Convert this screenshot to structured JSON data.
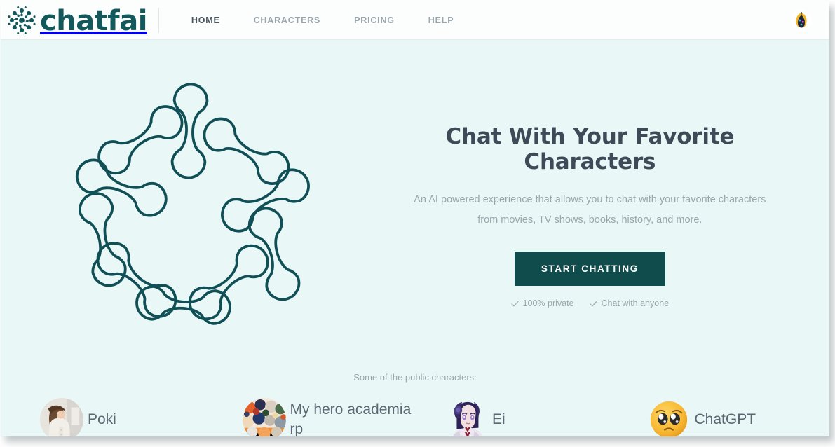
{
  "brand": {
    "name": "chatfai",
    "logo_icon": "network-nodes-icon",
    "color": "#13595c"
  },
  "nav": {
    "links": [
      {
        "label": "HOME",
        "active": true
      },
      {
        "label": "CHARACTERS",
        "active": false
      },
      {
        "label": "PRICING",
        "active": false
      },
      {
        "label": "HELP",
        "active": false
      }
    ],
    "avatar_icon": "user-avatar"
  },
  "hero": {
    "illustration_icon": "radial-dumbbell-pattern-illustration",
    "title": "Chat With Your Favorite Characters",
    "subtitle": "An AI powered experience that allows you to chat with your favorite characters from movies, TV shows, books, history, and more.",
    "cta_label": "START CHATTING",
    "cta_color": "#114c4c",
    "features": [
      {
        "icon": "check-icon",
        "label": "100% private"
      },
      {
        "icon": "check-icon",
        "label": "Chat with anyone"
      }
    ]
  },
  "public_characters": {
    "label": "Some of the public characters:",
    "items": [
      {
        "name": "Poki",
        "avatar_icon": "avatar-photo-woman"
      },
      {
        "name": "My hero academia rp",
        "avatar_icon": "avatar-anime-group"
      },
      {
        "name": "Ei",
        "avatar_icon": "avatar-anime-purple-hair"
      },
      {
        "name": "ChatGPT",
        "avatar_icon": "avatar-pleading-face-emoji"
      }
    ]
  },
  "colors": {
    "page_background": "#e9f8f6",
    "navbar_background": "#fcfefe",
    "accent_teal": "#114c4c",
    "heading": "#3e4a57",
    "muted_text": "#9aa6ad"
  }
}
